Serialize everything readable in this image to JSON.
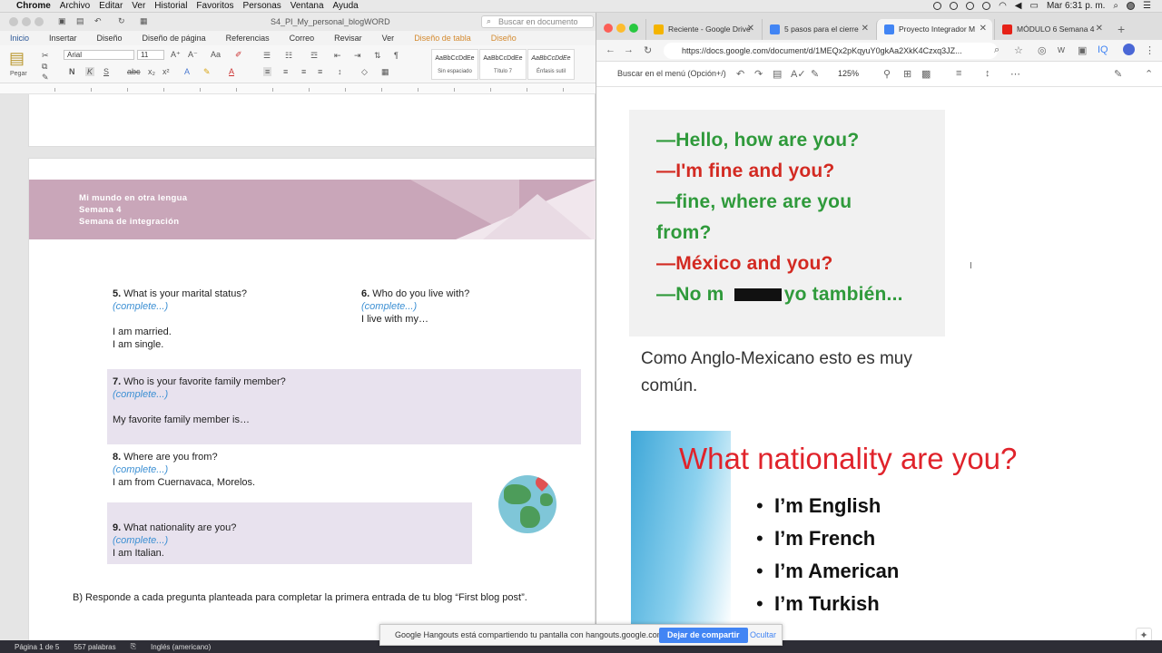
{
  "menubar": {
    "app": "Chrome",
    "items": [
      "Archivo",
      "Editar",
      "Ver",
      "Historial",
      "Favoritos",
      "Personas",
      "Ventana",
      "Ayuda"
    ],
    "clock": "Mar 6:31 p. m."
  },
  "word": {
    "doc_title": "S4_PI_My_personal_blogWORD",
    "search_placeholder": "Buscar en documento",
    "tabs": [
      "Inicio",
      "Insertar",
      "Diseño",
      "Diseño de página",
      "Referencias",
      "Correo",
      "Revisar",
      "Ver",
      "Diseño de tabla",
      "Diseño"
    ],
    "ribbon": {
      "paste": "Pegar",
      "font": "Arial",
      "size": "11",
      "styles": [
        {
          "sample": "AaBbCcDdEe",
          "label": "Sin espaciado"
        },
        {
          "sample": "AaBbCcDdEe",
          "label": "Título 7"
        },
        {
          "sample": "AaBbCcDdEe",
          "label": "Énfasis sutil"
        }
      ]
    },
    "banner": {
      "line1": "Mi mundo en otra lengua",
      "line2": "Semana 4",
      "line3": "Semana de integración"
    },
    "questions": {
      "q5": {
        "num": "5.",
        "text": " What is your marital status?",
        "hint": "(complete...)",
        "a1": "I am married.",
        "a2": "I am single."
      },
      "q6": {
        "num": "6.",
        "text": " Who do you live with?",
        "hint": "(complete...)",
        "a1": "I live with my…"
      },
      "q7": {
        "num": "7.",
        "text": " Who is your favorite family member?",
        "hint": "(complete...)",
        "a1": "My favorite family member is…"
      },
      "q8": {
        "num": "8.",
        "text": " Where are you from?",
        "hint": "(complete...)",
        "a1": "I am from Cuernavaca, Morelos."
      },
      "q9": {
        "num": "9.",
        "text": " What nationality are you?",
        "hint": "(complete...)",
        "a1": "I am Italian."
      }
    },
    "instruction": "B) Responde a cada pregunta planteada para completar la primera entrada de tu blog “First blog post”.",
    "status": {
      "page": "Página 1 de 5",
      "words": "557 palabras",
      "language": "Inglés (americano)"
    }
  },
  "chrome": {
    "tabs": [
      {
        "title": "Reciente - Google Drive",
        "color": "#f4b400"
      },
      {
        "title": "5 pasos para el cierre",
        "color": "#4285f4"
      },
      {
        "title": "Proyecto Integrador M",
        "color": "#4285f4"
      },
      {
        "title": "MÓDULO 6 Semana 4",
        "color": "#e62117"
      }
    ],
    "url": "https://docs.google.com/document/d/1MEQx2pKqyuY0gkAa2XkK4Czxq3JZ...",
    "menu_search": "Buscar en el menú (Opción+/)",
    "zoom": "125%",
    "image1_lines": [
      {
        "text": "—Hello, how are you?",
        "color": "green"
      },
      {
        "text": "—I'm fine and you?",
        "color": "red"
      },
      {
        "text": "—fine, where are you",
        "color": "green"
      },
      {
        "text": "from?",
        "color": "green"
      },
      {
        "text": "—México and you?",
        "color": "red"
      },
      {
        "text": "—No m        s yo también...",
        "color": "green"
      }
    ],
    "caption": "Como Anglo-Mexicano esto es muy común.",
    "image2": {
      "heading": "What nationality are you?",
      "items": [
        "I’m English",
        "I’m French",
        "I’m American",
        "I’m Turkish"
      ]
    }
  },
  "hangouts": {
    "message": "Google Hangouts está compartiendo tu pantalla con hangouts.google.com.",
    "stop": "Dejar de compartir",
    "hide": "Ocultar"
  }
}
